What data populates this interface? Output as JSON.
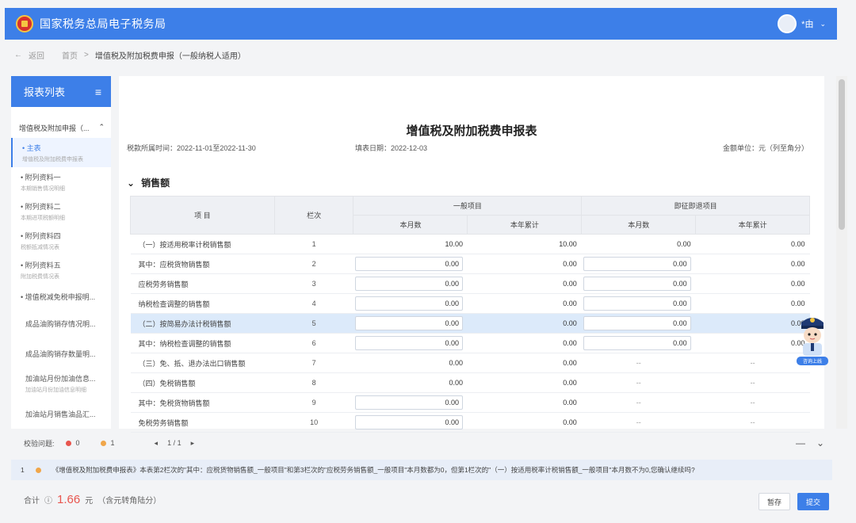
{
  "header": {
    "site_name": "国家税务总局电子税务局",
    "username": "*由"
  },
  "breadcrumb": {
    "back": "返回",
    "home": "首页",
    "separator": ">",
    "current": "增值税及附加税费申报（一般纳税人适用）"
  },
  "sidebar": {
    "title": "报表列表",
    "group_label": "增值税及附加申报（...",
    "items": [
      {
        "label": "主表",
        "sub": "增值税及附加税费申报表"
      },
      {
        "label": "附列资料一",
        "sub": "本期销售情况明细"
      },
      {
        "label": "附列资料二",
        "sub": "本期进项税额明细"
      },
      {
        "label": "附列资料四",
        "sub": "税额抵减情况表"
      },
      {
        "label": "附列资料五",
        "sub": "附加税费情况表"
      },
      {
        "label": "增值税减免税申报明...",
        "sub": ""
      },
      {
        "label": "成品油购销存情况明...",
        "sub": ""
      },
      {
        "label": "成品油购销存数量明...",
        "sub": ""
      },
      {
        "label": "加油站月份加油信息...",
        "sub": "加油站月份加油信息明细"
      },
      {
        "label": "加油站月销售油品汇...",
        "sub": ""
      }
    ]
  },
  "form": {
    "title": "增值税及附加税费申报表",
    "period": "税款所属时间：2022-11-01至2022-11-30",
    "fill_date": "填表日期：2022-12-03",
    "unit": "金额单位：元（列至角分）",
    "section_title": "销售额",
    "columns": {
      "item": "项 目",
      "seq": "栏次",
      "general": "一般项目",
      "immediate": "即征即退项目",
      "month": "本月数",
      "year": "本年累计"
    },
    "rows": [
      {
        "name": "（一）按适用税率计税销售额",
        "seq": "1",
        "v1": "10.00",
        "v2": "10.00",
        "v3": "0.00",
        "v4": "0.00"
      },
      {
        "name": "其中：应税货物销售额",
        "seq": "2",
        "v1": "0.00",
        "v2": "0.00",
        "v3": "0.00",
        "v4": "0.00"
      },
      {
        "name": "应税劳务销售额",
        "seq": "3",
        "v1": "0.00",
        "v2": "0.00",
        "v3": "0.00",
        "v4": "0.00"
      },
      {
        "name": "纳税检查调整的销售额",
        "seq": "4",
        "v1": "0.00",
        "v2": "0.00",
        "v3": "0.00",
        "v4": "0.00"
      },
      {
        "name": "（二）按简易办法计税销售额",
        "seq": "5",
        "v1": "0.00",
        "v2": "0.00",
        "v3": "0.00",
        "v4": "0.00"
      },
      {
        "name": "其中：纳税检查调整的销售额",
        "seq": "6",
        "v1": "0.00",
        "v2": "0.00",
        "v3": "0.00",
        "v4": "0.00"
      },
      {
        "name": "（三）免、抵、退办法出口销售额",
        "seq": "7",
        "v1": "0.00",
        "v2": "0.00",
        "v3": "--",
        "v4": "--"
      },
      {
        "name": "（四）免税销售额",
        "seq": "8",
        "v1": "0.00",
        "v2": "0.00",
        "v3": "--",
        "v4": "--"
      },
      {
        "name": "其中：免税货物销售额",
        "seq": "9",
        "v1": "0.00",
        "v2": "0.00",
        "v3": "--",
        "v4": "--"
      },
      {
        "name": "免税劳务销售额",
        "seq": "10",
        "v1": "0.00",
        "v2": "0.00",
        "v3": "--",
        "v4": "--"
      }
    ]
  },
  "mascot": {
    "label": "咨询上线"
  },
  "validation": {
    "label": "校验问题:",
    "errors": "0",
    "warnings": "1",
    "page": "1 / 1",
    "prev": "◂",
    "next": "▸",
    "collapse": "—",
    "expand": "⌄"
  },
  "message": {
    "index": "1",
    "text": "《增值税及附加税费申报表》本表第2栏次的\"其中：应税货物销售额_一般项目\"和第3栏次的\"应税劳务销售额_一般项目\"本月数都为0，但第1栏次的\"（一）按适用税率计税销售额_一般项目\"本月数不为0,您确认继续吗?"
  },
  "footer": {
    "total_label": "合计",
    "total_value": "1.66",
    "currency": "元",
    "note": "（含元转角陆分）"
  },
  "buttons": {
    "save": "暂存",
    "submit": "提交"
  },
  "colors": {
    "primary": "#3d7fe8",
    "error": "#e8554e",
    "warning": "#f0a64a",
    "highlight_row": "#dceafa"
  }
}
